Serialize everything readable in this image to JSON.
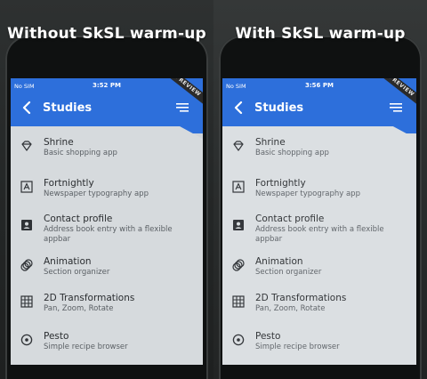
{
  "panels": [
    {
      "caption": "Without SkSL warm-up",
      "status": {
        "carrier": "No SIM",
        "time": "3:52 PM"
      },
      "ribbon": "PREVIEW",
      "appbar": {
        "title": "Studies"
      },
      "items": [
        {
          "name": "Shrine",
          "desc": "Basic shopping app",
          "icon": "diamond-icon"
        },
        {
          "name": "Fortnightly",
          "desc": "Newspaper typography app",
          "icon": "font-download-icon"
        },
        {
          "name": "Contact profile",
          "desc": "Address book entry with a flexible appbar",
          "icon": "account-box-icon"
        },
        {
          "name": "Animation",
          "desc": "Section organizer",
          "icon": "animation-icon"
        },
        {
          "name": "2D Transformations",
          "desc": "Pan, Zoom, Rotate",
          "icon": "grid-icon"
        },
        {
          "name": "Pesto",
          "desc": "Simple recipe browser",
          "icon": "adjust-icon"
        }
      ]
    },
    {
      "caption": "With SkSL warm-up",
      "status": {
        "carrier": "No SIM",
        "time": "3:56 PM"
      },
      "ribbon": "PREVIEW",
      "appbar": {
        "title": "Studies"
      },
      "items": [
        {
          "name": "Shrine",
          "desc": "Basic shopping app",
          "icon": "diamond-icon"
        },
        {
          "name": "Fortnightly",
          "desc": "Newspaper typography app",
          "icon": "font-download-icon"
        },
        {
          "name": "Contact profile",
          "desc": "Address book entry with a flexible appbar",
          "icon": "account-box-icon"
        },
        {
          "name": "Animation",
          "desc": "Section organizer",
          "icon": "animation-icon"
        },
        {
          "name": "2D Transformations",
          "desc": "Pan, Zoom, Rotate",
          "icon": "grid-icon"
        },
        {
          "name": "Pesto",
          "desc": "Simple recipe browser",
          "icon": "adjust-icon"
        }
      ]
    }
  ],
  "colors": {
    "appbar": "#2d6fdb",
    "sheet": "#d6dadd",
    "text": "#2a2d30"
  }
}
